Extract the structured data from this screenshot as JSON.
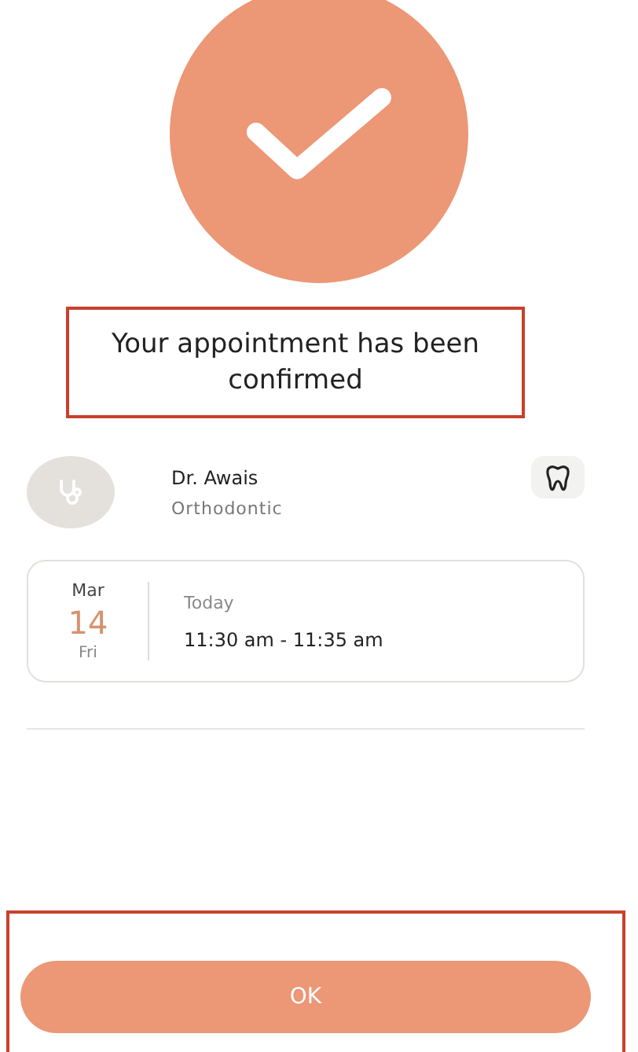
{
  "confirmation": {
    "title": "Your appointment has been confirmed"
  },
  "doctor": {
    "name": "Dr. Awais",
    "specialty": "Orthodontic"
  },
  "appointment": {
    "month": "Mar",
    "day": "14",
    "weekday": "Fri",
    "when": "Today",
    "time": "11:30 am - 11:35 am"
  },
  "buttons": [
    "OK"
  ]
}
